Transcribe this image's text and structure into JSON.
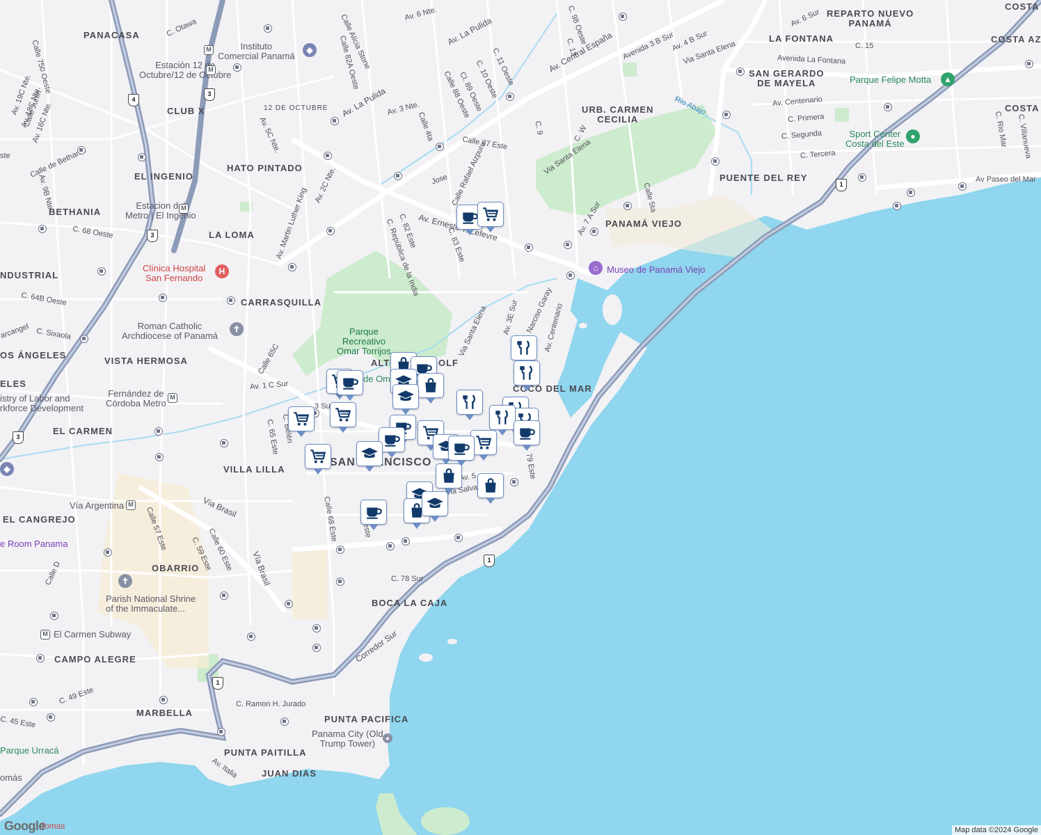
{
  "map": {
    "attribution": "Map data ©2024 Google",
    "logo": "Google",
    "neighborhoods": [
      {
        "id": "panacasa",
        "text": "PANACASA"
      },
      {
        "id": "club-x",
        "text": "CLUB X"
      },
      {
        "id": "hato-pintado",
        "text": "HATO PINTADO"
      },
      {
        "id": "el-ingenio",
        "text": "EL INGENIO"
      },
      {
        "id": "bethania",
        "text": "BETHANIA"
      },
      {
        "id": "la-loma",
        "text": "LA LOMA"
      },
      {
        "id": "ndustrial",
        "text": "NDUSTRIAL"
      },
      {
        "id": "carrasquilla",
        "text": "CARRASQUILLA"
      },
      {
        "id": "los-angeles",
        "text": "OS ÁNGELES"
      },
      {
        "id": "vista-hermosa",
        "text": "VISTA HERMOSA"
      },
      {
        "id": "eles",
        "text": "ELES"
      },
      {
        "id": "el-carmen",
        "text": "EL CARMEN"
      },
      {
        "id": "villa-lilla",
        "text": "VILLA LILLA"
      },
      {
        "id": "san-francisco",
        "text": "SAN FRANCISCO"
      },
      {
        "id": "el-cangrejo",
        "text": "EL CANGREJO"
      },
      {
        "id": "obarrio",
        "text": "OBARRIO"
      },
      {
        "id": "boca-la-caja",
        "text": "BOCA LA CAJA"
      },
      {
        "id": "campo-alegre",
        "text": "CAMPO ALEGRE"
      },
      {
        "id": "marbella",
        "text": "MARBELLA"
      },
      {
        "id": "punta-pacifica",
        "text": "PUNTA PACIFICA"
      },
      {
        "id": "punta-paitilla",
        "text": "PUNTA PAITILLA"
      },
      {
        "id": "juan-dias",
        "text": "JUAN DIAS"
      },
      {
        "id": "altos-del-golf",
        "text": "ALTOS DEL GOLF"
      },
      {
        "id": "coco-del-mar",
        "text": "COCO DEL MAR"
      },
      {
        "id": "panama-viejo",
        "text": "PANAMÁ VIEJO"
      },
      {
        "id": "urb-carmen-cecilia",
        "text": "URB. CARMEN\nCECILIA"
      },
      {
        "id": "puente-del-rey",
        "text": "PUENTE DEL REY"
      },
      {
        "id": "san-gerardo",
        "text": "SAN GERARDO\nDE MAYELA"
      },
      {
        "id": "la-fontana",
        "text": "LA FONTANA"
      },
      {
        "id": "reparto-nuevo-panama",
        "text": "REPARTO NUEVO\nPANAMÁ"
      },
      {
        "id": "costa",
        "text": "COSTA"
      },
      {
        "id": "costa-az",
        "text": "COSTA AZ"
      },
      {
        "id": "costa-2",
        "text": "COSTA"
      },
      {
        "id": "12-de-octubre",
        "text": "12 DE OCTUBRE"
      }
    ],
    "pois": [
      {
        "id": "instituto-comercial",
        "text": "Instituto\nComercial Panamá",
        "style": ""
      },
      {
        "id": "estacion-12-octubre",
        "text": "Estación 12 de\nOctubre/12 de Octubre",
        "style": ""
      },
      {
        "id": "estacion-el-ingenio",
        "text": "Estacion del\nMetro | El Ingenio",
        "style": ""
      },
      {
        "id": "clinica-san-fernando",
        "text": "Clínica Hospital\nSan Fernando",
        "style": "red"
      },
      {
        "id": "roman-catholic",
        "text": "Roman Catholic\nArchdiocese of Panamá",
        "style": ""
      },
      {
        "id": "ministry-labor",
        "text": "istry of Labor and\nrkforce Development",
        "style": ""
      },
      {
        "id": "fernandez-cordoba",
        "text": "Fernández de\nCórdoba Metro",
        "style": ""
      },
      {
        "id": "via-argentina",
        "text": "Vía Argentina",
        "style": ""
      },
      {
        "id": "room-panama",
        "text": "e Room Panama",
        "style": "purple"
      },
      {
        "id": "parish-shrine",
        "text": "Parish National Shrine\nof the Immaculate...",
        "style": ""
      },
      {
        "id": "el-carmen-subway",
        "text": "El Carmen Subway",
        "style": ""
      },
      {
        "id": "parque-urraca",
        "text": "Parque Urracá",
        "style": "green"
      },
      {
        "id": "panama-city-trump",
        "text": "Panama City (Old\nTrump Tower)",
        "style": ""
      },
      {
        "id": "parque-omar",
        "text": "Parque\nRecreativo\nOmar Torrijos",
        "style": "park"
      },
      {
        "id": "museo-panama-viejo",
        "text": "Museo de Panamá Viejo",
        "style": "purple"
      },
      {
        "id": "parque-felipe-motta",
        "text": "Parque Felipe Motta",
        "style": "green"
      },
      {
        "id": "sport-center",
        "text": "Sport Center\nCosta del Este",
        "style": "green"
      },
      {
        "id": "de-omar",
        "text": "de Omar",
        "style": "green"
      },
      {
        "id": "tomas",
        "text": "Tomas",
        "style": "red"
      },
      {
        "id": "omas",
        "text": "omás",
        "style": ""
      }
    ],
    "streets": [
      {
        "id": "av-la-pulida",
        "text": "Av. La Pulida"
      },
      {
        "id": "av-la-pulida-2",
        "text": "Av. La Pulida"
      },
      {
        "id": "av-central-espana",
        "text": "Av. Central España"
      },
      {
        "id": "av-ernesto-lefevre",
        "text": "Av. Ernesto T. Lefevre"
      },
      {
        "id": "via-brasil",
        "text": "Vía Brasil"
      },
      {
        "id": "via-brasil-2",
        "text": "Vía Brasil"
      },
      {
        "id": "corredor-sur",
        "text": "Corredor Sur"
      },
      {
        "id": "via-santa-elena",
        "text": "Via Santa Elena"
      },
      {
        "id": "via-santa-elena-2",
        "text": "Via Santa Elena"
      },
      {
        "id": "via-santa-elena-3",
        "text": "Via Santa Elena"
      },
      {
        "id": "av-centenario",
        "text": "Av. Centenario"
      },
      {
        "id": "av-paseo-del-mar",
        "text": "Av Paseo del Mar"
      },
      {
        "id": "avenida-la-fontana",
        "text": "Avenida La Fontana"
      },
      {
        "id": "calle-martin-luther-king",
        "text": "Av. Martin Luther King"
      },
      {
        "id": "c-78-sur",
        "text": "C. 78 Sur"
      },
      {
        "id": "c-ramon-jurado",
        "text": "C. Ramon H. Jurado"
      },
      {
        "id": "c-49-este",
        "text": "C. 49 Este"
      },
      {
        "id": "av-italia",
        "text": "Av. Italia"
      },
      {
        "id": "calle-68-este",
        "text": "Calle 68 Este"
      },
      {
        "id": "calle-57-este",
        "text": "Calle 57 Este"
      },
      {
        "id": "calle-60-este",
        "text": "Calle 60 Este"
      },
      {
        "id": "c-59-este",
        "text": "C. 59 Este"
      },
      {
        "id": "calle-d",
        "text": "Calle D"
      },
      {
        "id": "c-65-este",
        "text": "C. 65 Este"
      },
      {
        "id": "c-belen",
        "text": "C. Belén"
      },
      {
        "id": "av-1c-sur",
        "text": "Av. 1 C Sur"
      },
      {
        "id": "calle-65c",
        "text": "Calle 65C"
      },
      {
        "id": "c-64b-oeste",
        "text": "C. 64B Oeste"
      },
      {
        "id": "c-68-oeste",
        "text": "C. 68 Oeste"
      },
      {
        "id": "c-sixaola",
        "text": "C. Sixaola"
      },
      {
        "id": "calle-87-este",
        "text": "Calle 87 Este"
      },
      {
        "id": "calle-rafael-aizpuru",
        "text": "Calle Rafael Aizpuru"
      },
      {
        "id": "c-82-este",
        "text": "C. 82 Este"
      },
      {
        "id": "c-83-este",
        "text": "C. 83 Este"
      },
      {
        "id": "c-republica-india",
        "text": "C. República de la India"
      },
      {
        "id": "narciso-garay",
        "text": "Narciso Garay"
      },
      {
        "id": "av-3e-sur",
        "text": "Av. 3E Sur"
      },
      {
        "id": "av-7a-sur",
        "text": "Av. 7 A Sur"
      },
      {
        "id": "calle-5ta",
        "text": "Calle 5ta"
      },
      {
        "id": "c-primera",
        "text": "C. Primera"
      },
      {
        "id": "c-segunda",
        "text": "C. Segunda"
      },
      {
        "id": "c-tercera",
        "text": "C. Tercera"
      },
      {
        "id": "av-centenario-2",
        "text": "Av. Centenario"
      },
      {
        "id": "c-15",
        "text": "C. 15"
      },
      {
        "id": "av-6-sur",
        "text": "Av. 6 Sur"
      },
      {
        "id": "avenida-3b-sur",
        "text": "Avenida 3 B Sur"
      },
      {
        "id": "av-4b-sur",
        "text": "Av. 4 B Sur"
      },
      {
        "id": "c-98-oeste",
        "text": "C. 98 Oeste"
      },
      {
        "id": "c-13",
        "text": "C. 13"
      },
      {
        "id": "c-9",
        "text": "C. 9"
      },
      {
        "id": "c-w",
        "text": "C. W"
      },
      {
        "id": "av-6-nte",
        "text": "Av. 6 Nte."
      },
      {
        "id": "av-3-nte",
        "text": "Av. 3 Nte."
      },
      {
        "id": "calle-4ta",
        "text": "Calle 4ta"
      },
      {
        "id": "calle-alicia-stone",
        "text": "Calle Alicia Stone"
      },
      {
        "id": "calle-82a-oeste",
        "text": "Calle 82A Oeste"
      },
      {
        "id": "calle-88-oeste",
        "text": "Calle 88 Oeste"
      },
      {
        "id": "cl-89-oeste",
        "text": "Cl. 89 Oeste"
      },
      {
        "id": "c-10-oeste",
        "text": "C. 10 Oeste"
      },
      {
        "id": "c-11-oeste",
        "text": "C. 11 Oeste"
      },
      {
        "id": "c-otawa",
        "text": "C. Otawa"
      },
      {
        "id": "calle-750-oeste",
        "text": "Calle 750 Oeste"
      },
      {
        "id": "av-19c-nte",
        "text": "Av. 19C Nte."
      },
      {
        "id": "av-18c-nte",
        "text": "Av. 18C Nte."
      },
      {
        "id": "av-16c-nte",
        "text": "Av. 16C Nte."
      },
      {
        "id": "av-5c-nte",
        "text": "Av. 5C Nte."
      },
      {
        "id": "av-2c-nte",
        "text": "Av. 2C Nte."
      },
      {
        "id": "calle-bethania",
        "text": "Calle de Bethania"
      },
      {
        "id": "av-9b-nte",
        "text": "Av. 9B Nte"
      },
      {
        "id": "jose",
        "text": "Jose"
      },
      {
        "id": "rio-abajo",
        "text": "Río Abajo"
      },
      {
        "id": "c-rio-mar",
        "text": "C. Rio Mar"
      },
      {
        "id": "villanueva",
        "text": "C. Villanueva"
      },
      {
        "id": "c-45-este",
        "text": "C. 45 Este"
      },
      {
        "id": "calle-junin",
        "text": "Calle Junín"
      },
      {
        "id": "via-salvador",
        "text": "Via Salvador"
      },
      {
        "id": "av-5",
        "text": "Av. 5"
      },
      {
        "id": "79-este",
        "text": "79 Este"
      },
      {
        "id": "oeste",
        "text": "Oeste"
      },
      {
        "id": "carcangel",
        "text": "arcangel"
      },
      {
        "id": "ste",
        "text": "ste"
      },
      {
        "id": "c-49-sur-short",
        "text": "3 Sur"
      }
    ],
    "place_pins": [
      {
        "id": "pin-1",
        "icon": "coffee-icon"
      },
      {
        "id": "pin-2",
        "icon": "cart-icon"
      },
      {
        "id": "pin-3",
        "icon": "restaurant-icon"
      },
      {
        "id": "pin-4",
        "icon": "restaurant-icon"
      },
      {
        "id": "pin-5",
        "icon": "bag-icon"
      },
      {
        "id": "pin-6",
        "icon": "coffee-icon"
      },
      {
        "id": "pin-7",
        "icon": "school-icon"
      },
      {
        "id": "pin-8",
        "icon": "bag-icon"
      },
      {
        "id": "pin-9",
        "icon": "school-icon"
      },
      {
        "id": "pin-10",
        "icon": "cart-icon"
      },
      {
        "id": "pin-11",
        "icon": "coffee-icon"
      },
      {
        "id": "pin-12",
        "icon": "cart-icon"
      },
      {
        "id": "pin-13",
        "icon": "cart-icon"
      },
      {
        "id": "pin-14",
        "icon": "restaurant-icon"
      },
      {
        "id": "pin-15",
        "icon": "restaurant-icon"
      },
      {
        "id": "pin-16",
        "icon": "restaurant-icon"
      },
      {
        "id": "pin-17",
        "icon": "restaurant-icon"
      },
      {
        "id": "pin-18",
        "icon": "coffee-icon"
      },
      {
        "id": "pin-19",
        "icon": "coffee-icon"
      },
      {
        "id": "pin-20",
        "icon": "cart-icon"
      },
      {
        "id": "pin-21",
        "icon": "cart-icon"
      },
      {
        "id": "pin-22",
        "icon": "school-icon"
      },
      {
        "id": "pin-23",
        "icon": "school-icon"
      },
      {
        "id": "pin-24",
        "icon": "coffee-icon"
      },
      {
        "id": "pin-25",
        "icon": "cart-icon"
      },
      {
        "id": "pin-26",
        "icon": "bag-icon"
      },
      {
        "id": "pin-27",
        "icon": "bag-icon"
      },
      {
        "id": "pin-28",
        "icon": "school-icon"
      },
      {
        "id": "pin-29",
        "icon": "bag-icon"
      },
      {
        "id": "pin-30",
        "icon": "coffee-icon"
      },
      {
        "id": "pin-31",
        "icon": "school-icon"
      },
      {
        "id": "pin-32",
        "icon": "coffee-icon"
      }
    ],
    "route_shields": [
      "1",
      "1",
      "1",
      "3",
      "3",
      "3",
      "4"
    ]
  }
}
